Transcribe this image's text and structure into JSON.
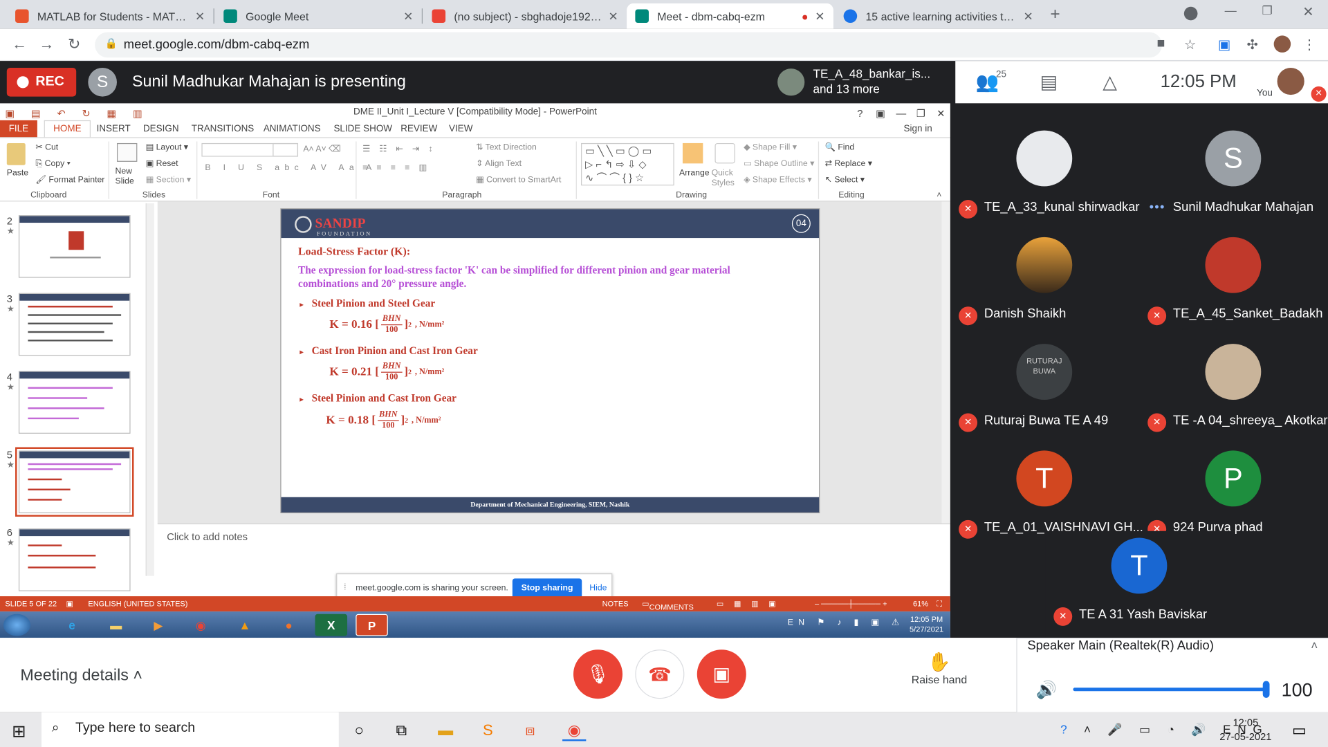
{
  "browser": {
    "tabs": [
      {
        "title": "MATLAB for Students - MATLAB &",
        "color": "#e8542d"
      },
      {
        "title": "Google Meet",
        "color": "#00897b"
      },
      {
        "title": "(no subject) - sbghadoje1922192",
        "color": "#ea4335"
      },
      {
        "title": "Meet - dbm-cabq-ezm",
        "color": "#00897b"
      },
      {
        "title": "15 active learning activities to en",
        "color": "#1a73e8"
      }
    ],
    "url": "meet.google.com/dbm-cabq-ezm"
  },
  "meet": {
    "rec_label": "REC",
    "presenter_initial": "S",
    "presenting_text": "Sunil Madhukar Mahajan is presenting",
    "others_line1": "TE_A_48_bankar_is...",
    "others_line2": "and 13 more",
    "participant_count": "25",
    "clock": "12:05 PM",
    "you_label": "You"
  },
  "ppt": {
    "window_title": "DME II_Unit I_Lecture V [Compatibility Mode] - PowerPoint",
    "tabs": [
      "FILE",
      "HOME",
      "INSERT",
      "DESIGN",
      "TRANSITIONS",
      "ANIMATIONS",
      "SLIDE SHOW",
      "REVIEW",
      "VIEW"
    ],
    "sign_in": "Sign in",
    "ribbon": {
      "paste": "Paste",
      "cut": "Cut",
      "copy": "Copy",
      "format_painter": "Format Painter",
      "new_slide": "New Slide",
      "layout": "Layout",
      "reset": "Reset",
      "section": "Section",
      "text_direction": "Text Direction",
      "align_text": "Align Text",
      "convert_smartart": "Convert to SmartArt",
      "arrange": "Arrange",
      "quick_styles": "Quick Styles",
      "shape_fill": "Shape Fill",
      "shape_outline": "Shape Outline",
      "shape_effects": "Shape Effects",
      "find": "Find",
      "replace": "Replace",
      "select": "Select",
      "groups": [
        "Clipboard",
        "Slides",
        "Font",
        "Paragraph",
        "Drawing",
        "Editing"
      ]
    },
    "thumb_numbers": [
      "2",
      "3",
      "4",
      "5",
      "6"
    ],
    "slide": {
      "logo": "SANDIP",
      "logo_sub": "FOUNDATION",
      "page_no": "04",
      "heading": "Load-Stress Factor (K):",
      "paragraph": "The expression for load-stress factor 'K' can be simplified for different pinion and gear material combinations and 20°   pressure angle.",
      "bullet_1": "Steel Pinion and Steel Gear",
      "formula_1_k": "K = 0.16",
      "bullet_2": "Cast Iron Pinion and Cast Iron Gear",
      "formula_2_k": "K = 0.21",
      "bullet_3": "Steel Pinion and Cast Iron Gear",
      "formula_3_k": "K = 0.18",
      "frac_num": "BHN",
      "frac_den": "100",
      "power": "2",
      "unit": ", N/mm²",
      "footer": "Department of Mechanical Engineering, SIEM, Nashik"
    },
    "notes_placeholder": "Click to add notes",
    "status": {
      "slide": "SLIDE 5 OF 22",
      "lang": "ENGLISH (UNITED STATES)",
      "notes": "NOTES",
      "comments": "COMMENTS",
      "zoom": "61%"
    },
    "share_banner": {
      "message": "meet.google.com is sharing your screen.",
      "stop": "Stop sharing",
      "hide": "Hide"
    },
    "win7": {
      "lang": "EN",
      "time": "12:05 PM",
      "date": "5/27/2021"
    }
  },
  "participants": [
    {
      "name": "TE_A_33_kunal shirwadkar",
      "initial": "",
      "color": "#e8eaed",
      "muted": true
    },
    {
      "name": "Sunil Madhukar Mahajan",
      "initial": "S",
      "color": "#9aa0a6",
      "muted": false
    },
    {
      "name": "Danish Shaikh",
      "initial": "",
      "color": "#8a6a3a",
      "muted": true
    },
    {
      "name": "TE_A_45_Sanket_Badakh",
      "initial": "",
      "color": "#c0392b",
      "muted": true
    },
    {
      "name": "Ruturaj Buwa TE A 49",
      "initial": "RUTURAJ BUWA",
      "color": "#3c4043",
      "muted": true
    },
    {
      "name": "TE -A 04_shreeya_ Akotkar",
      "initial": "",
      "color": "#c9b49a",
      "muted": true
    },
    {
      "name": "TE_A_01_VAISHNAVI GH...",
      "initial": "T",
      "color": "#d24720",
      "muted": true
    },
    {
      "name": "924 Purva phad",
      "initial": "P",
      "color": "#1e8e3e",
      "muted": true
    }
  ],
  "last_participant": {
    "name": "TE A 31 Yash Baviskar",
    "initial": "T",
    "color": "#1967d2"
  },
  "controls": {
    "meeting_details": "Meeting details",
    "raise_hand": "Raise hand"
  },
  "speaker": {
    "label": "Speaker Main (Realtek(R) Audio)",
    "volume": "100"
  },
  "taskbar": {
    "search_placeholder": "Type here to search",
    "lang": "ENG",
    "time": "12:05",
    "date": "27-05-2021"
  }
}
